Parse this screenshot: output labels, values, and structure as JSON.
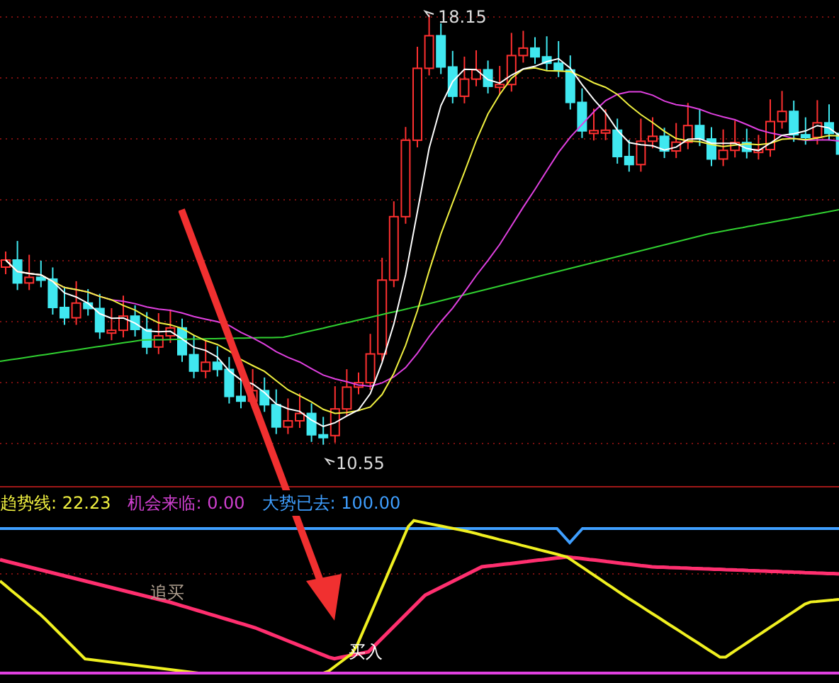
{
  "main_chart": {
    "high_label": "18.15",
    "low_label": "10.55"
  },
  "indicator": {
    "values": [
      {
        "text": "趋势线: 22.23",
        "color": "#f0f040"
      },
      {
        "text": "机会来临: 0.00",
        "color": "#d040d0"
      },
      {
        "text": "大势已去: 100.00",
        "color": "#3f9fff"
      }
    ],
    "annotations": [
      {
        "text": "追买"
      },
      {
        "text": "买入"
      }
    ]
  }
}
